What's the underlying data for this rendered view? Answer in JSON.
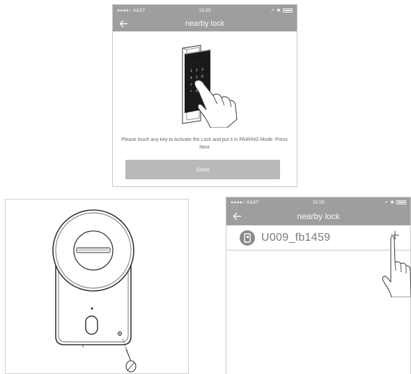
{
  "screen1": {
    "status": {
      "carrier": "●●●●○ A&AT",
      "time": "16:59"
    },
    "nav_title": "nearby lock",
    "instruction": "Please touch any key to Activate the Lock and put it in PAIRING Mode. Press Next",
    "next_label": "Next"
  },
  "screen2": {
    "status": {
      "carrier": "●●●●○ A&AT",
      "time": "16:59"
    },
    "nav_title": "nearby lock",
    "lock_name": "U009_fb1459"
  },
  "colors": {
    "bar": "#9e9e9e",
    "button": "#b9b9b9",
    "text": "#666666"
  }
}
